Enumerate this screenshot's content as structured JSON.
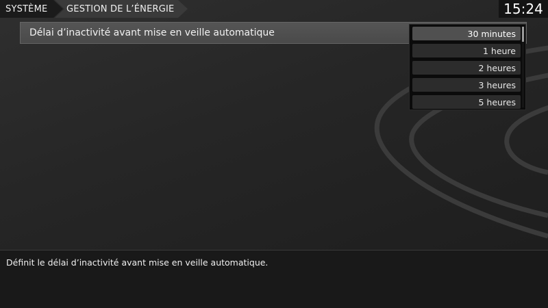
{
  "breadcrumb": {
    "items": [
      "SYSTÈME",
      "GESTION DE L’ÉNERGIE"
    ]
  },
  "clock": "15:24",
  "setting": {
    "label": "Délai d’inactivité avant mise en veille automatique",
    "selected_value": "30 minutes",
    "options": [
      "30 minutes",
      "1 heure",
      "2 heures",
      "3 heures",
      "5 heures"
    ]
  },
  "description": "Définit le délai d’inactivité avant mise en veille automatique.",
  "colors": {
    "background": "#262626",
    "selected_option": "#505050",
    "dropdown": "#0b0b0b"
  }
}
